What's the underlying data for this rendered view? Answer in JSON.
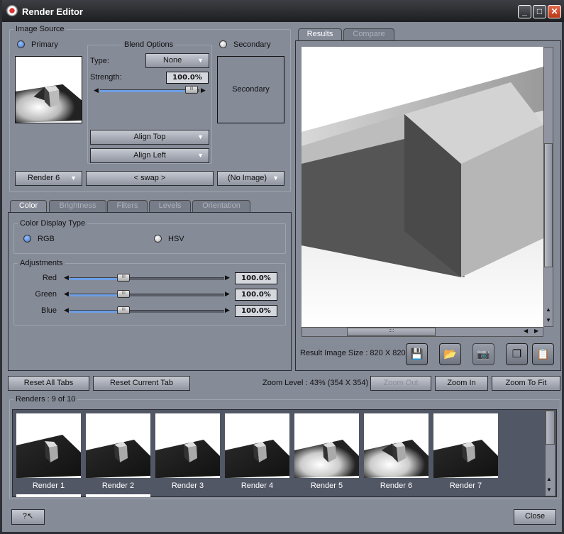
{
  "window": {
    "title": "Render Editor",
    "minimize": "_",
    "maximize": "□",
    "close": "✕"
  },
  "image_source": {
    "label": "Image Source",
    "primary_label": "Primary",
    "secondary_label": "Secondary",
    "secondary_placeholder": "Secondary",
    "primary_select": "Render 6",
    "swap_label": "< swap >",
    "secondary_select": "(No Image)"
  },
  "blend": {
    "label": "Blend Options",
    "type_label": "Type:",
    "type_value": "None",
    "strength_label": "Strength:",
    "strength_value": "100.0%",
    "strength_percent": 100,
    "align_top": "Align Top",
    "align_left": "Align Left"
  },
  "tabs": [
    {
      "label": "Color",
      "active": true
    },
    {
      "label": "Brightness"
    },
    {
      "label": "Filters"
    },
    {
      "label": "Levels"
    },
    {
      "label": "Orientation"
    }
  ],
  "color_tab": {
    "display_type_label": "Color Display Type",
    "rgb_label": "RGB",
    "hsv_label": "HSV",
    "selected": "RGB",
    "adjustments_label": "Adjustments",
    "sliders": [
      {
        "label": "Red",
        "value": "100.0%",
        "position": 0.35
      },
      {
        "label": "Green",
        "value": "100.0%",
        "position": 0.35
      },
      {
        "label": "Blue",
        "value": "100.0%",
        "position": 0.35
      }
    ]
  },
  "results": {
    "tabs": [
      {
        "label": "Results",
        "active": true
      },
      {
        "label": "Compare"
      }
    ],
    "size_text": "Result Image Size : 820 X 820",
    "icons": [
      "save-icon",
      "open-folder-icon",
      "camera-icon",
      "copy-icon",
      "paste-icon"
    ]
  },
  "buttons": {
    "reset_all": "Reset All Tabs",
    "reset_current": "Reset Current Tab",
    "zoom_level": "Zoom Level : 43% (354 X 354)",
    "zoom_out": "Zoom Out",
    "zoom_in": "Zoom In",
    "zoom_fit": "Zoom To Fit",
    "close": "Close"
  },
  "renders": {
    "label": "Renders : 9 of 10",
    "items": [
      {
        "label": "Render 1",
        "lit": false
      },
      {
        "label": "Render 2",
        "lit": false
      },
      {
        "label": "Render 3",
        "lit": false
      },
      {
        "label": "Render 4",
        "lit": false
      },
      {
        "label": "Render 5",
        "lit": true
      },
      {
        "label": "Render 6",
        "lit": true
      },
      {
        "label": "Render 7",
        "lit": false
      }
    ]
  }
}
